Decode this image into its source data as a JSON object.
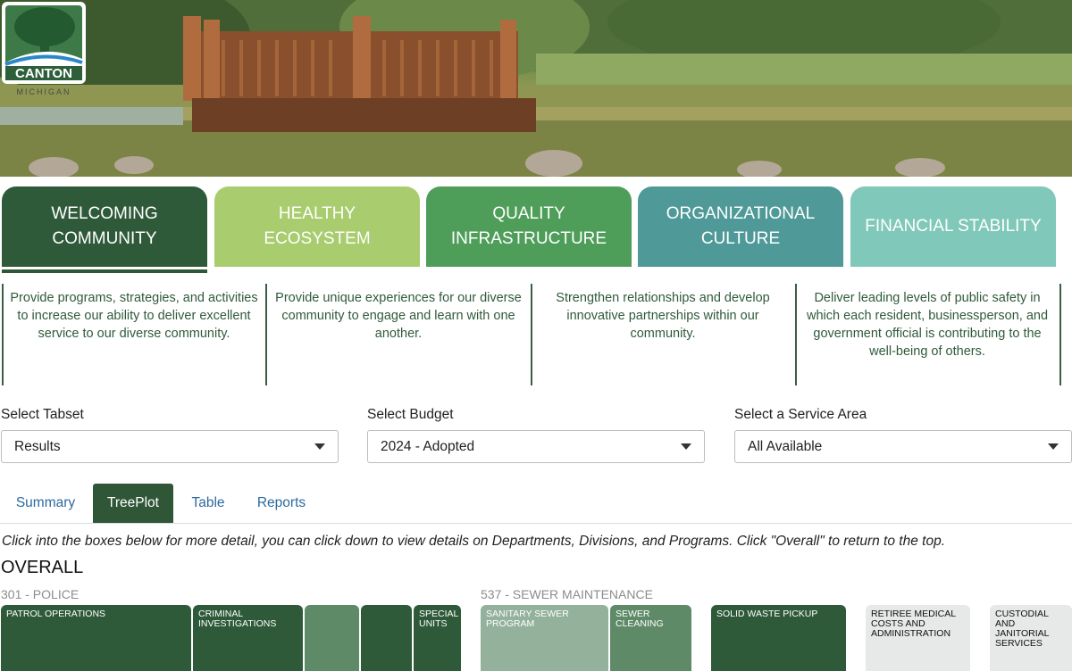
{
  "logo": {
    "name": "CANTON",
    "sub": "MICHIGAN"
  },
  "categories": [
    {
      "line1": "WELCOMING",
      "line2": "COMMUNITY",
      "color": "#2f5a3a"
    },
    {
      "line1": "HEALTHY ECOSYSTEM",
      "line2": "",
      "color": "#a8cc6e"
    },
    {
      "line1": "QUALITY",
      "line2": "INFRASTRUCTURE",
      "color": "#4e9e5a"
    },
    {
      "line1": "ORGANIZATIONAL",
      "line2": "CULTURE",
      "color": "#4f9a98"
    },
    {
      "line1": "FINANCIAL STABILITY",
      "line2": "",
      "color": "#80c8b9"
    }
  ],
  "descriptions": [
    "Provide programs, strategies, and activities to increase our ability to deliver excellent service to our diverse community.",
    "Provide unique experiences for our diverse community to engage and learn with one another.",
    "Strengthen relationships and develop innovative partnerships within our community.",
    "Deliver leading levels of public safety in which each resident, businessperson, and government official is contributing to the well-being of others."
  ],
  "selects": {
    "tabset": {
      "label": "Select Tabset",
      "value": "Results"
    },
    "budget": {
      "label": "Select Budget",
      "value": "2024 - Adopted"
    },
    "service_area": {
      "label": "Select a Service Area",
      "value": "All Available"
    }
  },
  "tabs": [
    "Summary",
    "TreePlot",
    "Table",
    "Reports"
  ],
  "active_tab": "TreePlot",
  "instructions": "Click into the boxes below for more detail, you can click down to view details on Departments, Divisions, and Programs. Click \"Overall\" to return to the top.",
  "overall_title": "OVERALL",
  "treemap": {
    "groups": [
      "301 - POLICE",
      "537 - SEWER MAINTENANCE"
    ],
    "boxes": [
      {
        "label": "PATROL OPERATIONS",
        "color": "#2f5a3a"
      },
      {
        "label": "CRIMINAL INVESTIGATIONS",
        "color": "#2f5a3a"
      },
      {
        "label": "",
        "color": "#5e8a68"
      },
      {
        "label": "",
        "color": "#2f5a3a"
      },
      {
        "label": "SPECIAL UNITS",
        "color": "#2f5a3a"
      },
      {
        "label": "SANITARY SEWER PROGRAM",
        "color": "#94b19c"
      },
      {
        "label": "SEWER CLEANING",
        "color": "#5e8a68"
      },
      {
        "label": "SOLID WASTE PICKUP",
        "color": "#2f5a3a"
      },
      {
        "label": "RETIREE MEDICAL COSTS AND ADMINISTRATION",
        "color": "#e6e9e7"
      },
      {
        "label": "CUSTODIAL AND JANITORIAL SERVICES",
        "color": "#e6e9e7"
      }
    ]
  }
}
